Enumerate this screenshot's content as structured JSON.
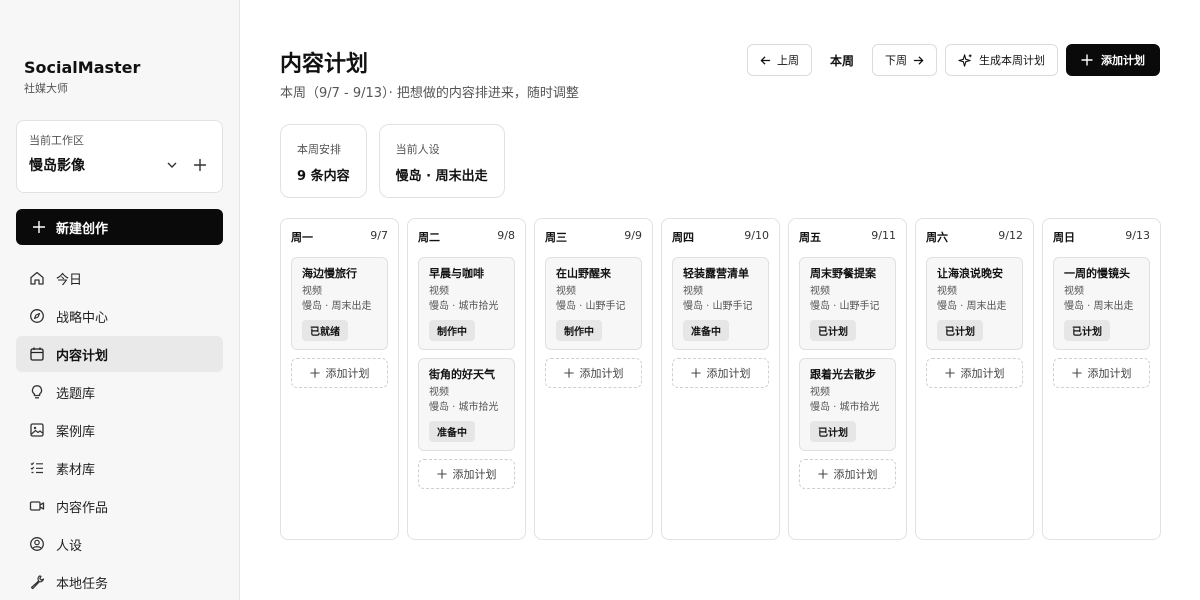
{
  "brand": {
    "name": "SocialMaster",
    "subtitle": "社媒大师"
  },
  "workspace": {
    "label": "当前工作区",
    "value": "慢岛影像"
  },
  "new_button": {
    "label": "新建创作"
  },
  "nav": [
    {
      "label": "今日",
      "icon": "home-icon",
      "active": false
    },
    {
      "label": "战略中心",
      "icon": "compass-icon",
      "active": false
    },
    {
      "label": "内容计划",
      "icon": "calendar-icon",
      "active": true
    },
    {
      "label": "选题库",
      "icon": "lightbulb-icon",
      "active": false
    },
    {
      "label": "案例库",
      "icon": "image-gallery-icon",
      "active": false
    },
    {
      "label": "素材库",
      "icon": "checklist-icon",
      "active": false
    },
    {
      "label": "内容作品",
      "icon": "video-icon",
      "active": false
    },
    {
      "label": "人设",
      "icon": "user-circle-icon",
      "active": false
    },
    {
      "label": "本地任务",
      "icon": "wrench-icon",
      "active": false
    }
  ],
  "header": {
    "title": "内容计划",
    "subtitle": "本周（9/7 - 9/13）· 把想做的内容排进来，随时调整"
  },
  "toolbar": {
    "prev": "上周",
    "current": "本周",
    "next": "下周",
    "generate": "生成本周计划",
    "add": "添加计划"
  },
  "stats": [
    {
      "label": "本周安排",
      "value": "9 条内容"
    },
    {
      "label": "当前人设",
      "value": "慢岛 · 周末出走"
    }
  ],
  "add_plan_label": "添加计划",
  "colors": {
    "primary": "#0a0a0a",
    "card_bg": "#f7f7f7",
    "status_bg": "#e6e6e6",
    "sidebar_bg": "#f7f7f7"
  },
  "days": [
    {
      "name": "周一",
      "date": "9/7",
      "cards": [
        {
          "title": "海边慢旅行",
          "type": "视频",
          "tag": "慢岛 · 周末出走",
          "status": "已就绪"
        }
      ]
    },
    {
      "name": "周二",
      "date": "9/8",
      "cards": [
        {
          "title": "早晨与咖啡",
          "type": "视频",
          "tag": "慢岛 · 城市拾光",
          "status": "制作中"
        },
        {
          "title": "街角的好天气",
          "type": "视频",
          "tag": "慢岛 · 城市拾光",
          "status": "准备中"
        }
      ]
    },
    {
      "name": "周三",
      "date": "9/9",
      "cards": [
        {
          "title": "在山野醒来",
          "type": "视频",
          "tag": "慢岛 · 山野手记",
          "status": "制作中"
        }
      ]
    },
    {
      "name": "周四",
      "date": "9/10",
      "cards": [
        {
          "title": "轻装露营清单",
          "type": "视频",
          "tag": "慢岛 · 山野手记",
          "status": "准备中"
        }
      ]
    },
    {
      "name": "周五",
      "date": "9/11",
      "cards": [
        {
          "title": "周末野餐提案",
          "type": "视频",
          "tag": "慢岛 · 山野手记",
          "status": "已计划"
        },
        {
          "title": "跟着光去散步",
          "type": "视频",
          "tag": "慢岛 · 城市拾光",
          "status": "已计划"
        }
      ]
    },
    {
      "name": "周六",
      "date": "9/12",
      "cards": [
        {
          "title": "让海浪说晚安",
          "type": "视频",
          "tag": "慢岛 · 周末出走",
          "status": "已计划"
        }
      ]
    },
    {
      "name": "周日",
      "date": "9/13",
      "cards": [
        {
          "title": "一周的慢镜头",
          "type": "视频",
          "tag": "慢岛 · 周末出走",
          "status": "已计划"
        }
      ]
    }
  ]
}
